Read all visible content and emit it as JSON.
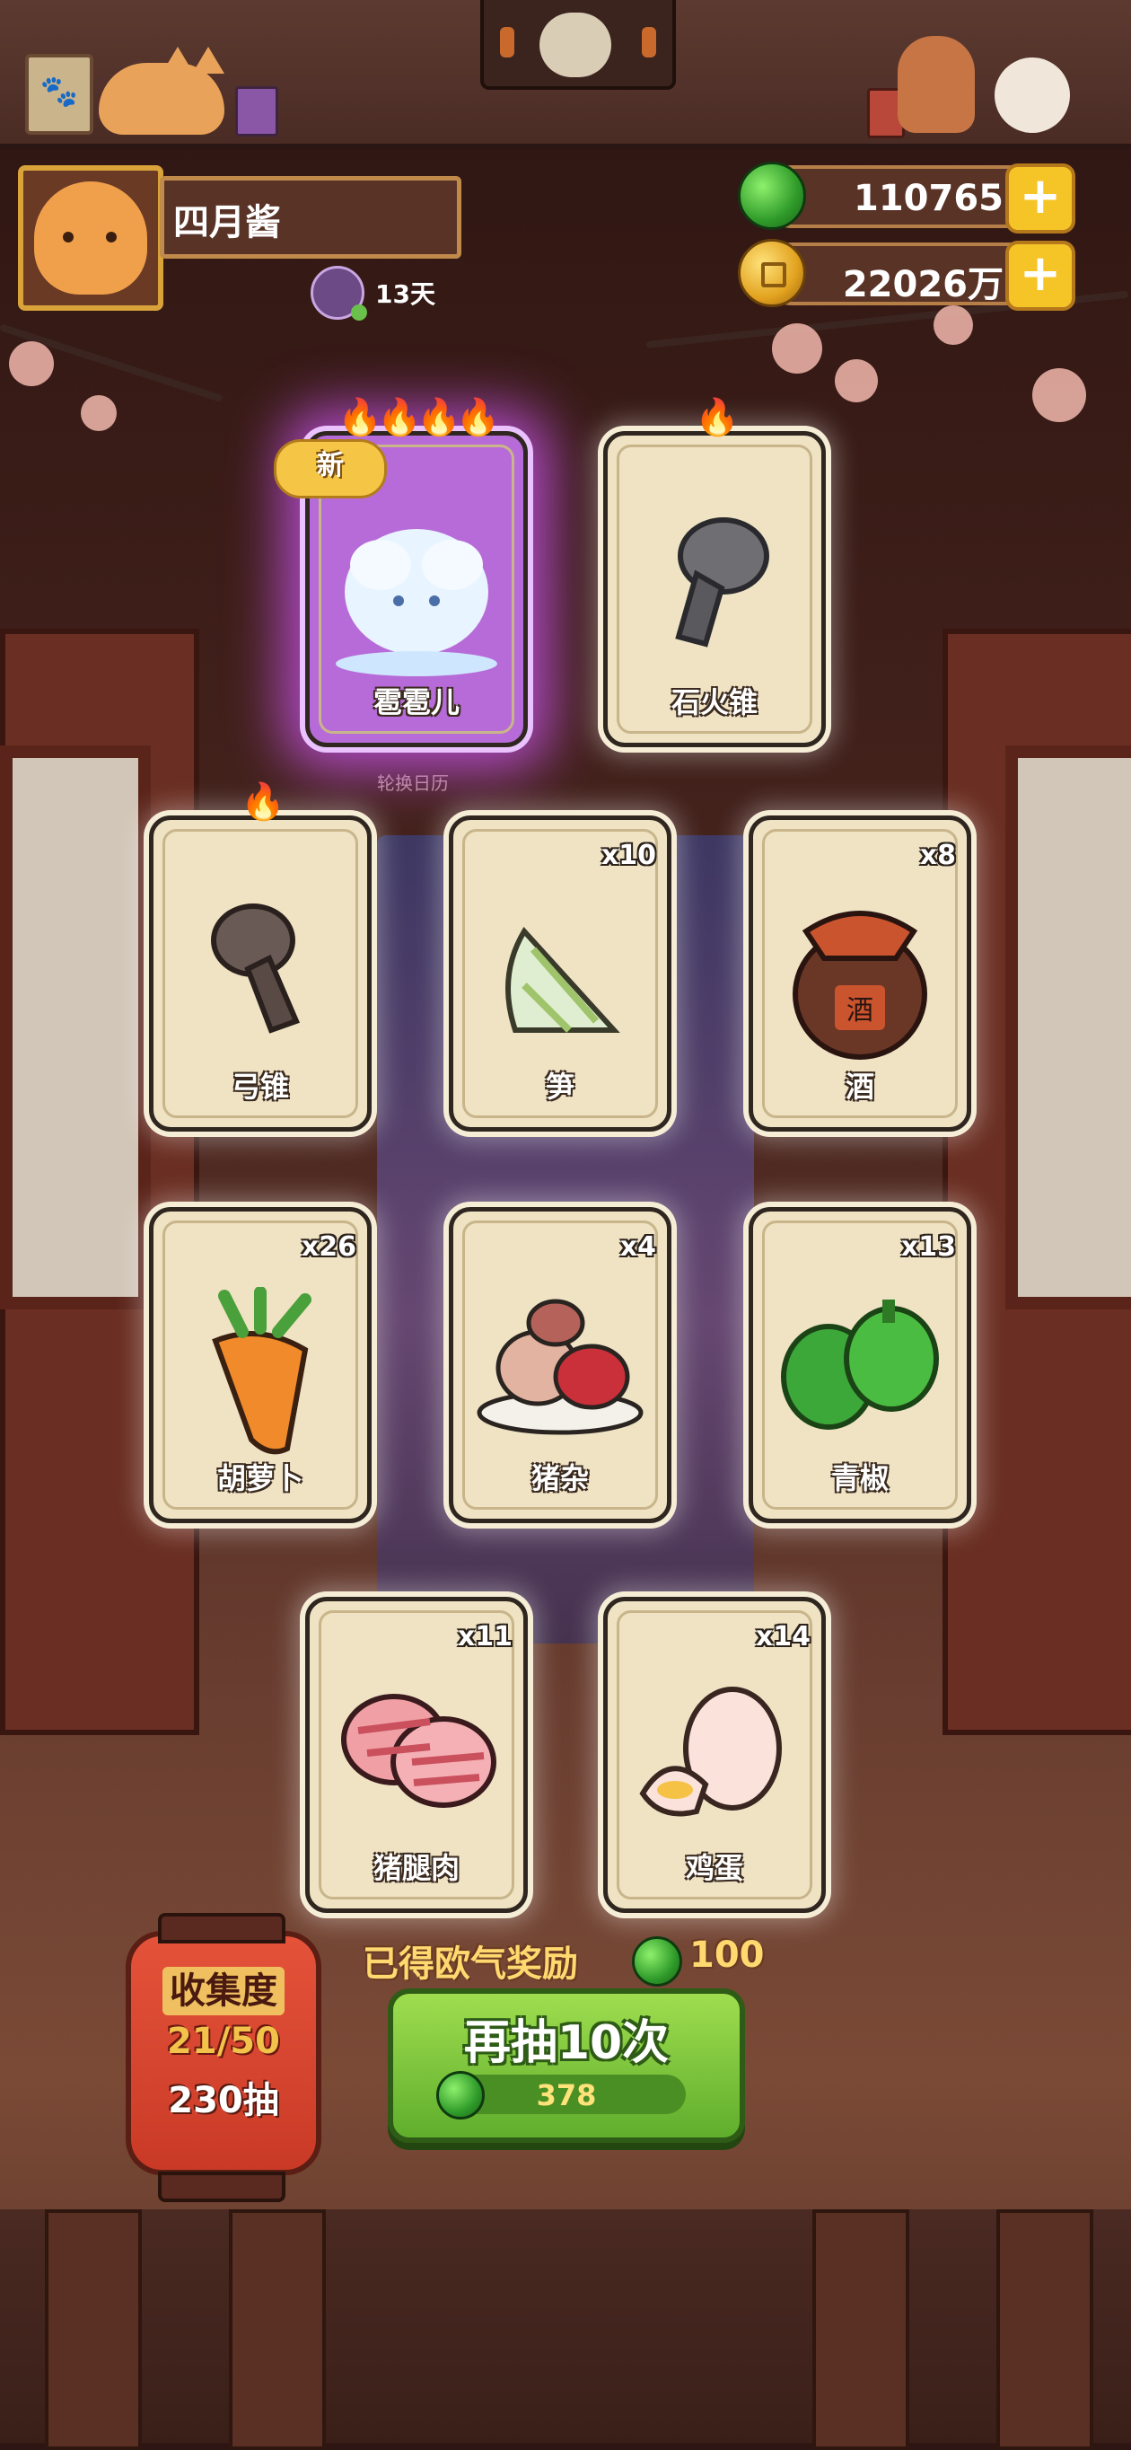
{
  "player": {
    "name": "四月酱",
    "streak": "13天"
  },
  "currency": {
    "jade": "110765",
    "coins": "22026万"
  },
  "cards": [
    {
      "name": "雹雹儿",
      "count": "",
      "flames": 4,
      "is_new": true,
      "new_label": "新",
      "rarity": "legendary",
      "icon": "cloud-spirit-icon"
    },
    {
      "name": "石火锥",
      "count": "",
      "flames": 1,
      "is_new": false,
      "rarity": "rare",
      "icon": "stone-cone-icon"
    },
    {
      "name": "弓锥",
      "count": "",
      "flames": 1,
      "is_new": false,
      "rarity": "rare",
      "icon": "bow-cone-icon"
    },
    {
      "name": "笋",
      "count": "x10",
      "flames": 0,
      "rarity": "common",
      "icon": "bamboo-shoot-icon"
    },
    {
      "name": "酒",
      "count": "x8",
      "flames": 0,
      "rarity": "common",
      "icon": "wine-jar-icon"
    },
    {
      "name": "胡萝卜",
      "count": "x26",
      "flames": 0,
      "rarity": "common",
      "icon": "carrot-icon"
    },
    {
      "name": "猪杂",
      "count": "x4",
      "flames": 0,
      "rarity": "common",
      "icon": "pork-offal-icon"
    },
    {
      "name": "青椒",
      "count": "x13",
      "flames": 0,
      "rarity": "common",
      "icon": "green-pepper-icon"
    },
    {
      "name": "猪腿肉",
      "count": "x11",
      "flames": 0,
      "rarity": "common",
      "icon": "pork-leg-icon"
    },
    {
      "name": "鸡蛋",
      "count": "x14",
      "flames": 0,
      "rarity": "common",
      "icon": "egg-icon"
    }
  ],
  "background_label": "轮换日历",
  "wine_glyph": "酒",
  "reward": {
    "label": "已得欧气奖励",
    "value": "100"
  },
  "redraw": {
    "label": "再抽10次",
    "cost": "378"
  },
  "collection": {
    "title": "收集度",
    "progress": "21/50",
    "draws": "230抽"
  },
  "colors": {
    "jade": "#2f9b2a",
    "gold": "#f5c528",
    "legendary_glow": "#d65aff",
    "button_green": "#5fae2c"
  }
}
